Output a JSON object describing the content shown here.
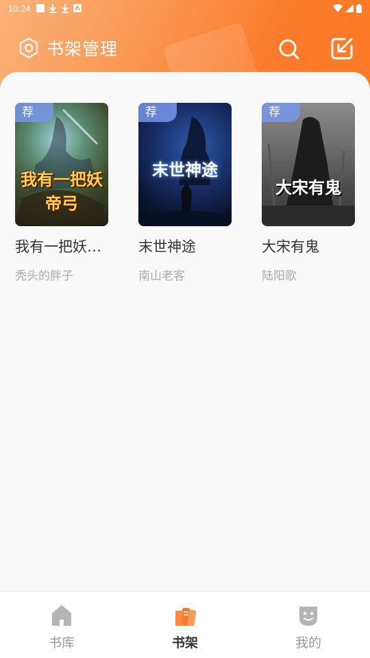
{
  "status_bar": {
    "time": "10:24"
  },
  "header": {
    "manage_label": "书架管理",
    "manage_icon": "settings-hex-icon",
    "search_icon": "search-icon",
    "import_icon": "import-arrow-icon"
  },
  "books": [
    {
      "title": "我有一把妖…",
      "author": "秃头的胖子",
      "badge": "荐",
      "cover_text": "我有一把妖帝弓"
    },
    {
      "title": "末世神途",
      "author": "南山老客",
      "badge": "荐",
      "cover_text": "末世神途"
    },
    {
      "title": "大宋有鬼",
      "author": "陆阳歌",
      "badge": "荐",
      "cover_text": "大宋有鬼"
    }
  ],
  "bottom_nav": {
    "items": [
      {
        "label": "书库",
        "icon": "home-icon",
        "active": false
      },
      {
        "label": "书架",
        "icon": "books-icon",
        "active": true
      },
      {
        "label": "我的",
        "icon": "face-icon",
        "active": false
      }
    ]
  },
  "colors": {
    "accent": "#fd7a22",
    "badge": "#7896eb",
    "inactive": "#999999"
  }
}
